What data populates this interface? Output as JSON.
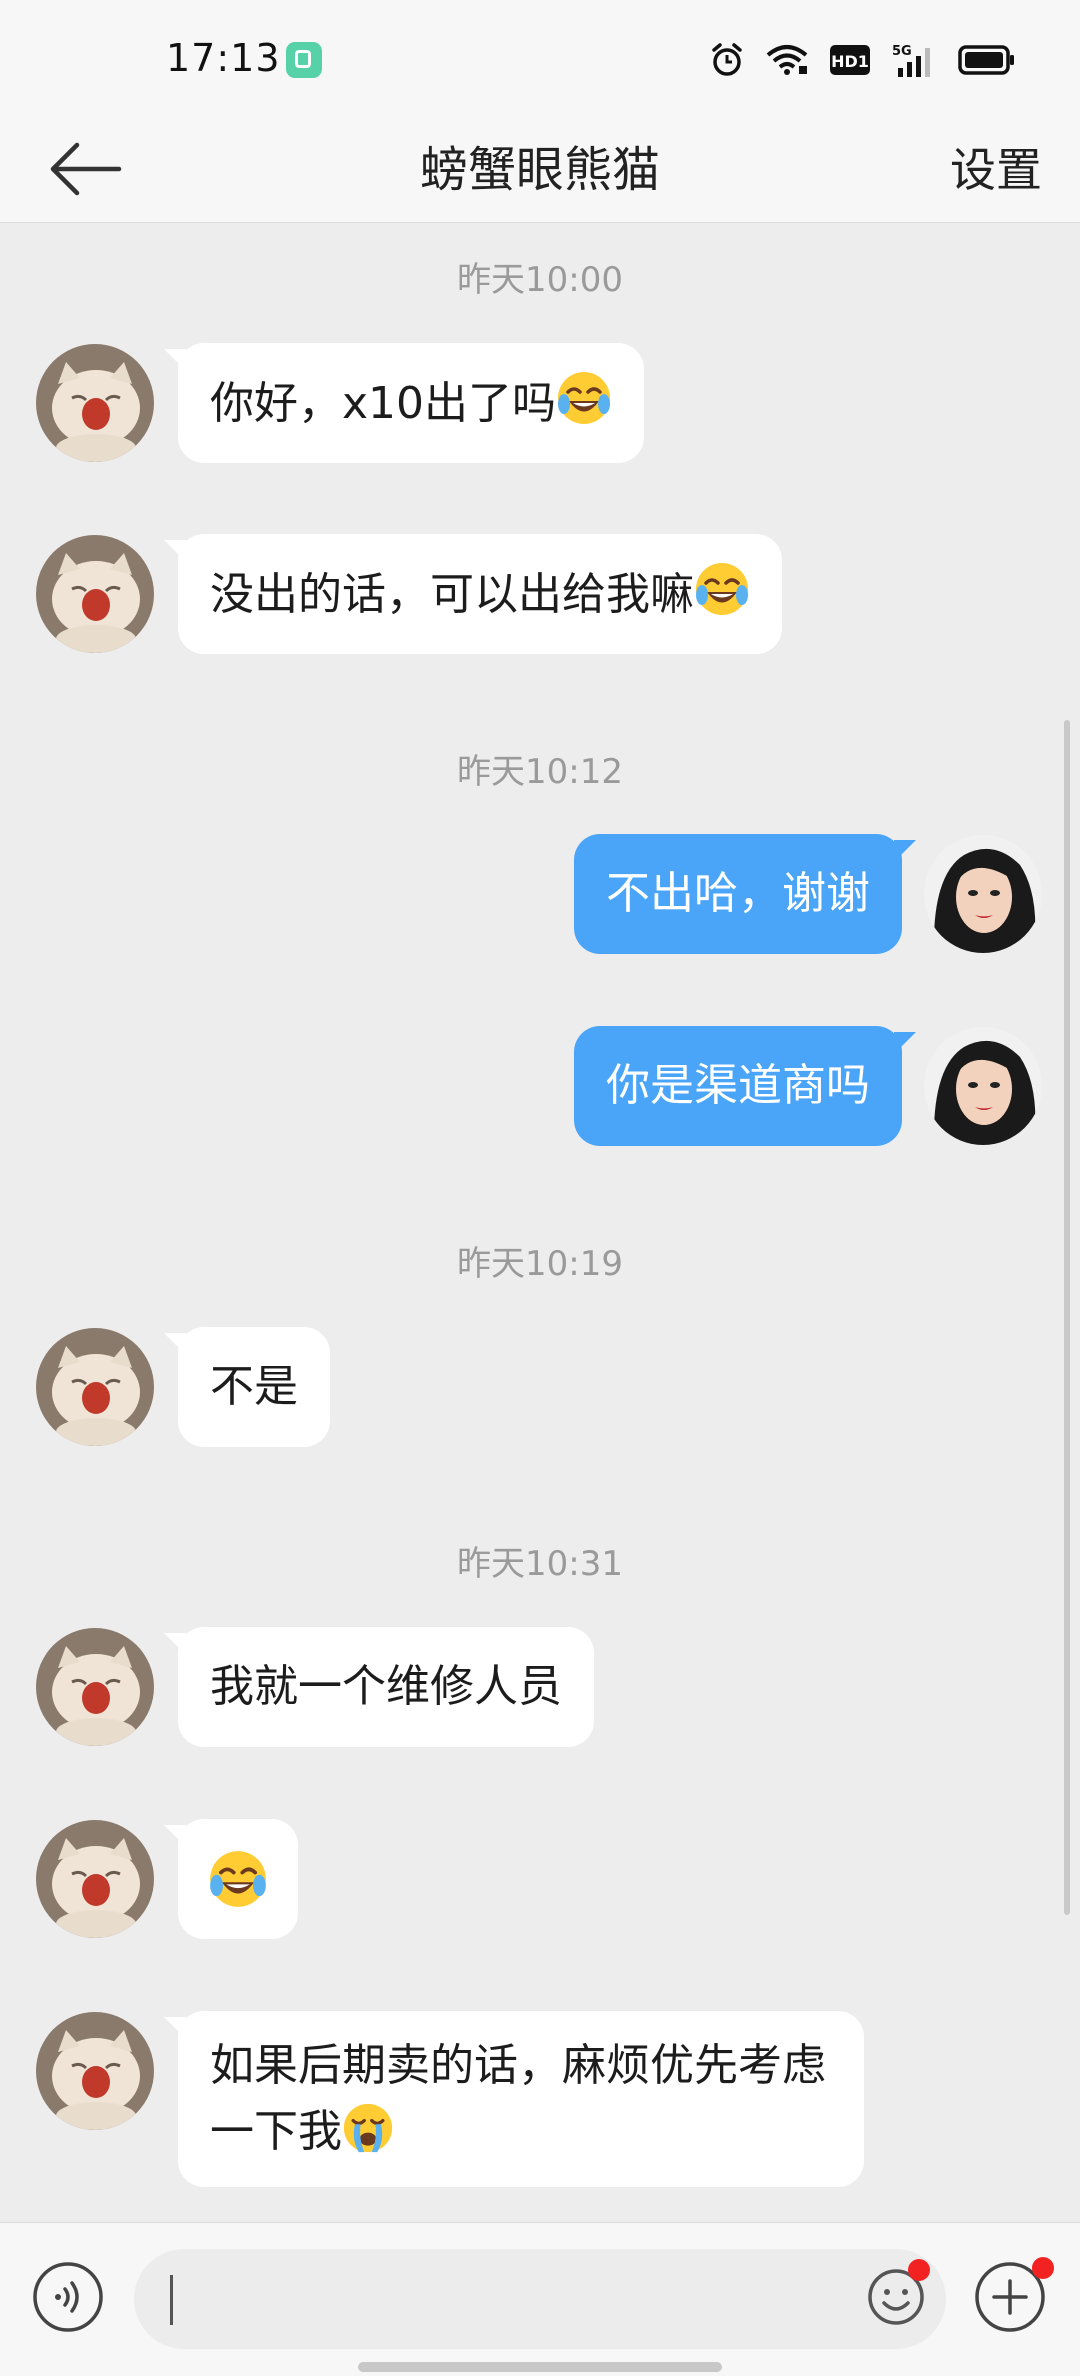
{
  "status_bar": {
    "time": "17:13",
    "network": "5G",
    "hd_label": "HD1"
  },
  "nav": {
    "title": "螃蟹眼熊猫",
    "settings_label": "设置"
  },
  "messages": {
    "ts1": "昨天10:00",
    "m1": "你好，x10出了吗",
    "m2": "没出的话，可以出给我嘛",
    "ts2": "昨天10:12",
    "m3": "不出哈，谢谢",
    "m4": "你是渠道商吗",
    "ts3": "昨天10:19",
    "m5": "不是",
    "ts4": "昨天10:31",
    "m6": "我就一个维修人员",
    "m8": "如果后期卖的话，麻烦优先考虑一下我"
  },
  "input_bar": {
    "placeholder": ""
  },
  "colors": {
    "outgoing_bubble": "#4aa4f8",
    "incoming_bubble": "#ffffff",
    "background": "#ededed",
    "badge": "#f32222"
  },
  "icons": {
    "laugh": "face-with-tears-of-joy-emoji",
    "cry": "loudly-crying-face-emoji",
    "voice": "voice-icon",
    "emoji": "smiley-icon",
    "plus": "plus-circle-icon"
  }
}
